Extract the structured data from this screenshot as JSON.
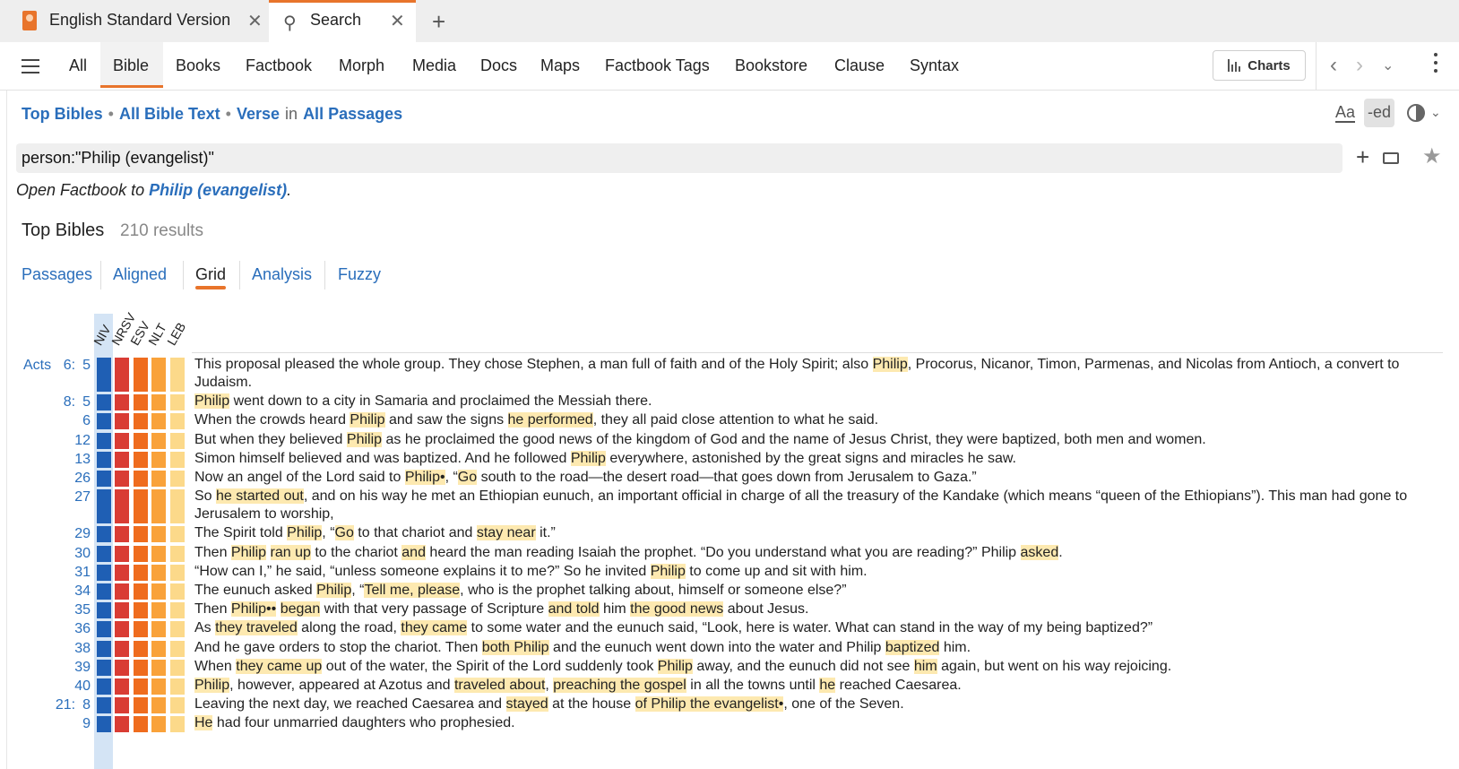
{
  "tabs": [
    {
      "label": "English Standard Version",
      "active": false
    },
    {
      "label": "Search",
      "active": true
    }
  ],
  "nav": {
    "items": [
      "All",
      "Bible",
      "Books",
      "Factbook",
      "Morph",
      "Media",
      "Docs",
      "Maps",
      "Factbook Tags",
      "Bookstore",
      "Clause",
      "Syntax"
    ],
    "active": "Bible",
    "charts_label": "Charts"
  },
  "breadcrumb": {
    "scope": "Top Bibles",
    "corpus": "All Bible Text",
    "unit": "Verse",
    "in_label": "in",
    "range": "All Passages"
  },
  "tools": {
    "aa_label": "Aa",
    "ed_label": "-ed"
  },
  "search": {
    "query": "person:\"Philip (evangelist)\""
  },
  "factbook": {
    "prefix": "Open Factbook to ",
    "link": "Philip (evangelist)",
    "suffix": "."
  },
  "results": {
    "title": "Top Bibles",
    "count": "210 results"
  },
  "view_tabs": [
    "Passages",
    "Aligned",
    "Grid",
    "Analysis",
    "Fuzzy"
  ],
  "active_view": "Grid",
  "versions": [
    "NIV",
    "NRSV",
    "ESV",
    "NLT",
    "LEB"
  ],
  "colors": {
    "accent": "#e8742b",
    "link": "#2a6ebb",
    "highlight": "#fde9b0",
    "niv": "#1f5fb4",
    "nrsv": "#d93c34",
    "esv": "#ef6c1e",
    "nlt": "#f9a23a",
    "leb": "#fcd98a"
  },
  "rows": [
    {
      "book": "Acts",
      "chapter": "6:",
      "verse": "5",
      "lines": 2,
      "segments": [
        {
          "t": "This proposal pleased the whole group. They chose Stephen, a man full of faith and of the Holy Spirit; also "
        },
        {
          "t": "Philip",
          "h": true
        },
        {
          "t": ", Procorus, Nicanor, Timon, Parmenas, and Nicolas from Antioch, a convert to Judaism."
        }
      ]
    },
    {
      "book": "",
      "chapter": "8:",
      "verse": "5",
      "lines": 1,
      "segments": [
        {
          "t": "Philip",
          "h": true
        },
        {
          "t": " went down to a city in Samaria and proclaimed the Messiah there."
        }
      ]
    },
    {
      "book": "",
      "chapter": "",
      "verse": "6",
      "lines": 1,
      "segments": [
        {
          "t": "When the crowds heard "
        },
        {
          "t": "Philip",
          "h": true
        },
        {
          "t": " and saw the signs "
        },
        {
          "t": "he performed",
          "h": true
        },
        {
          "t": ", they all paid close attention to what he said."
        }
      ]
    },
    {
      "book": "",
      "chapter": "",
      "verse": "12",
      "lines": 1,
      "segments": [
        {
          "t": "But when they believed "
        },
        {
          "t": "Philip",
          "h": true
        },
        {
          "t": " as he proclaimed the good news of the kingdom of God and the name of Jesus Christ, they were baptized, both men and women."
        }
      ]
    },
    {
      "book": "",
      "chapter": "",
      "verse": "13",
      "lines": 1,
      "segments": [
        {
          "t": "Simon himself believed and was baptized. And he followed "
        },
        {
          "t": "Philip",
          "h": true
        },
        {
          "t": " everywhere, astonished by the great signs and miracles he saw."
        }
      ]
    },
    {
      "book": "",
      "chapter": "",
      "verse": "26",
      "lines": 1,
      "segments": [
        {
          "t": "Now an angel of the Lord said to "
        },
        {
          "t": "Philip•",
          "h": true
        },
        {
          "t": ", “"
        },
        {
          "t": "Go",
          "h": true
        },
        {
          "t": " south to the road—the desert road—that goes down from Jerusalem to Gaza.”"
        }
      ]
    },
    {
      "book": "",
      "chapter": "",
      "verse": "27",
      "lines": 2,
      "segments": [
        {
          "t": "So "
        },
        {
          "t": "he started out",
          "h": true
        },
        {
          "t": ", and on his way he met an Ethiopian eunuch, an important official in charge of all the treasury of the Kandake (which means “queen of the Ethiopians”). This man had gone to Jerusalem to worship,"
        }
      ]
    },
    {
      "book": "",
      "chapter": "",
      "verse": "29",
      "lines": 1,
      "segments": [
        {
          "t": "The Spirit told "
        },
        {
          "t": "Philip",
          "h": true
        },
        {
          "t": ", “"
        },
        {
          "t": "Go",
          "h": true
        },
        {
          "t": " to that chariot and "
        },
        {
          "t": "stay near",
          "h": true
        },
        {
          "t": " it.”"
        }
      ]
    },
    {
      "book": "",
      "chapter": "",
      "verse": "30",
      "lines": 1,
      "segments": [
        {
          "t": "Then "
        },
        {
          "t": "Philip",
          "h": true
        },
        {
          "t": " "
        },
        {
          "t": "ran up",
          "h": true
        },
        {
          "t": " to the chariot "
        },
        {
          "t": "and",
          "h": true
        },
        {
          "t": " heard the man reading Isaiah the prophet. “Do you understand what you are reading?” Philip "
        },
        {
          "t": "asked",
          "h": true
        },
        {
          "t": "."
        }
      ]
    },
    {
      "book": "",
      "chapter": "",
      "verse": "31",
      "lines": 1,
      "segments": [
        {
          "t": "“How can I,” he said, “unless someone explains it to me?” So he invited "
        },
        {
          "t": "Philip",
          "h": true
        },
        {
          "t": " to come up and sit with him."
        }
      ]
    },
    {
      "book": "",
      "chapter": "",
      "verse": "34",
      "lines": 1,
      "segments": [
        {
          "t": "The eunuch asked "
        },
        {
          "t": "Philip",
          "h": true
        },
        {
          "t": ", “"
        },
        {
          "t": "Tell me, please",
          "h": true
        },
        {
          "t": ", who is the prophet talking about, himself or someone else?”"
        }
      ]
    },
    {
      "book": "",
      "chapter": "",
      "verse": "35",
      "lines": 1,
      "segments": [
        {
          "t": "Then "
        },
        {
          "t": "Philip••",
          "h": true
        },
        {
          "t": " "
        },
        {
          "t": "began",
          "h": true
        },
        {
          "t": " with that very passage of Scripture "
        },
        {
          "t": "and told",
          "h": true
        },
        {
          "t": " him "
        },
        {
          "t": "the good news",
          "h": true
        },
        {
          "t": " about Jesus."
        }
      ]
    },
    {
      "book": "",
      "chapter": "",
      "verse": "36",
      "lines": 1,
      "segments": [
        {
          "t": "As "
        },
        {
          "t": "they traveled",
          "h": true
        },
        {
          "t": " along the road, "
        },
        {
          "t": "they came",
          "h": true
        },
        {
          "t": " to some water and the eunuch said, “Look, here is water. What can stand in the way of my being baptized?”"
        }
      ]
    },
    {
      "book": "",
      "chapter": "",
      "verse": "38",
      "lines": 1,
      "segments": [
        {
          "t": "And he gave orders to stop the chariot. Then "
        },
        {
          "t": "both Philip",
          "h": true
        },
        {
          "t": " and the eunuch went down into the water and Philip "
        },
        {
          "t": "baptized",
          "h": true
        },
        {
          "t": " him."
        }
      ]
    },
    {
      "book": "",
      "chapter": "",
      "verse": "39",
      "lines": 1,
      "segments": [
        {
          "t": "When "
        },
        {
          "t": "they came up",
          "h": true
        },
        {
          "t": " out of the water, the Spirit of the Lord suddenly took "
        },
        {
          "t": "Philip",
          "h": true
        },
        {
          "t": " away, and the eunuch did not see "
        },
        {
          "t": "him",
          "h": true
        },
        {
          "t": " again, but went on his way rejoicing."
        }
      ]
    },
    {
      "book": "",
      "chapter": "",
      "verse": "40",
      "lines": 1,
      "segments": [
        {
          "t": "Philip",
          "h": true
        },
        {
          "t": ", however, appeared at Azotus and "
        },
        {
          "t": "traveled about",
          "h": true
        },
        {
          "t": ", "
        },
        {
          "t": "preaching the gospel",
          "h": true
        },
        {
          "t": " in all the towns until "
        },
        {
          "t": "he",
          "h": true
        },
        {
          "t": " reached Caesarea."
        }
      ]
    },
    {
      "book": "",
      "chapter": "21:",
      "verse": "8",
      "lines": 1,
      "segments": [
        {
          "t": "Leaving the next day, we reached Caesarea and "
        },
        {
          "t": "stayed",
          "h": true
        },
        {
          "t": " at the house "
        },
        {
          "t": "of Philip the evangelist•",
          "h": true
        },
        {
          "t": ", one of the Seven."
        }
      ]
    },
    {
      "book": "",
      "chapter": "",
      "verse": "9",
      "lines": 1,
      "segments": [
        {
          "t": "He",
          "h": true
        },
        {
          "t": " had four unmarried daughters who prophesied."
        }
      ]
    }
  ]
}
